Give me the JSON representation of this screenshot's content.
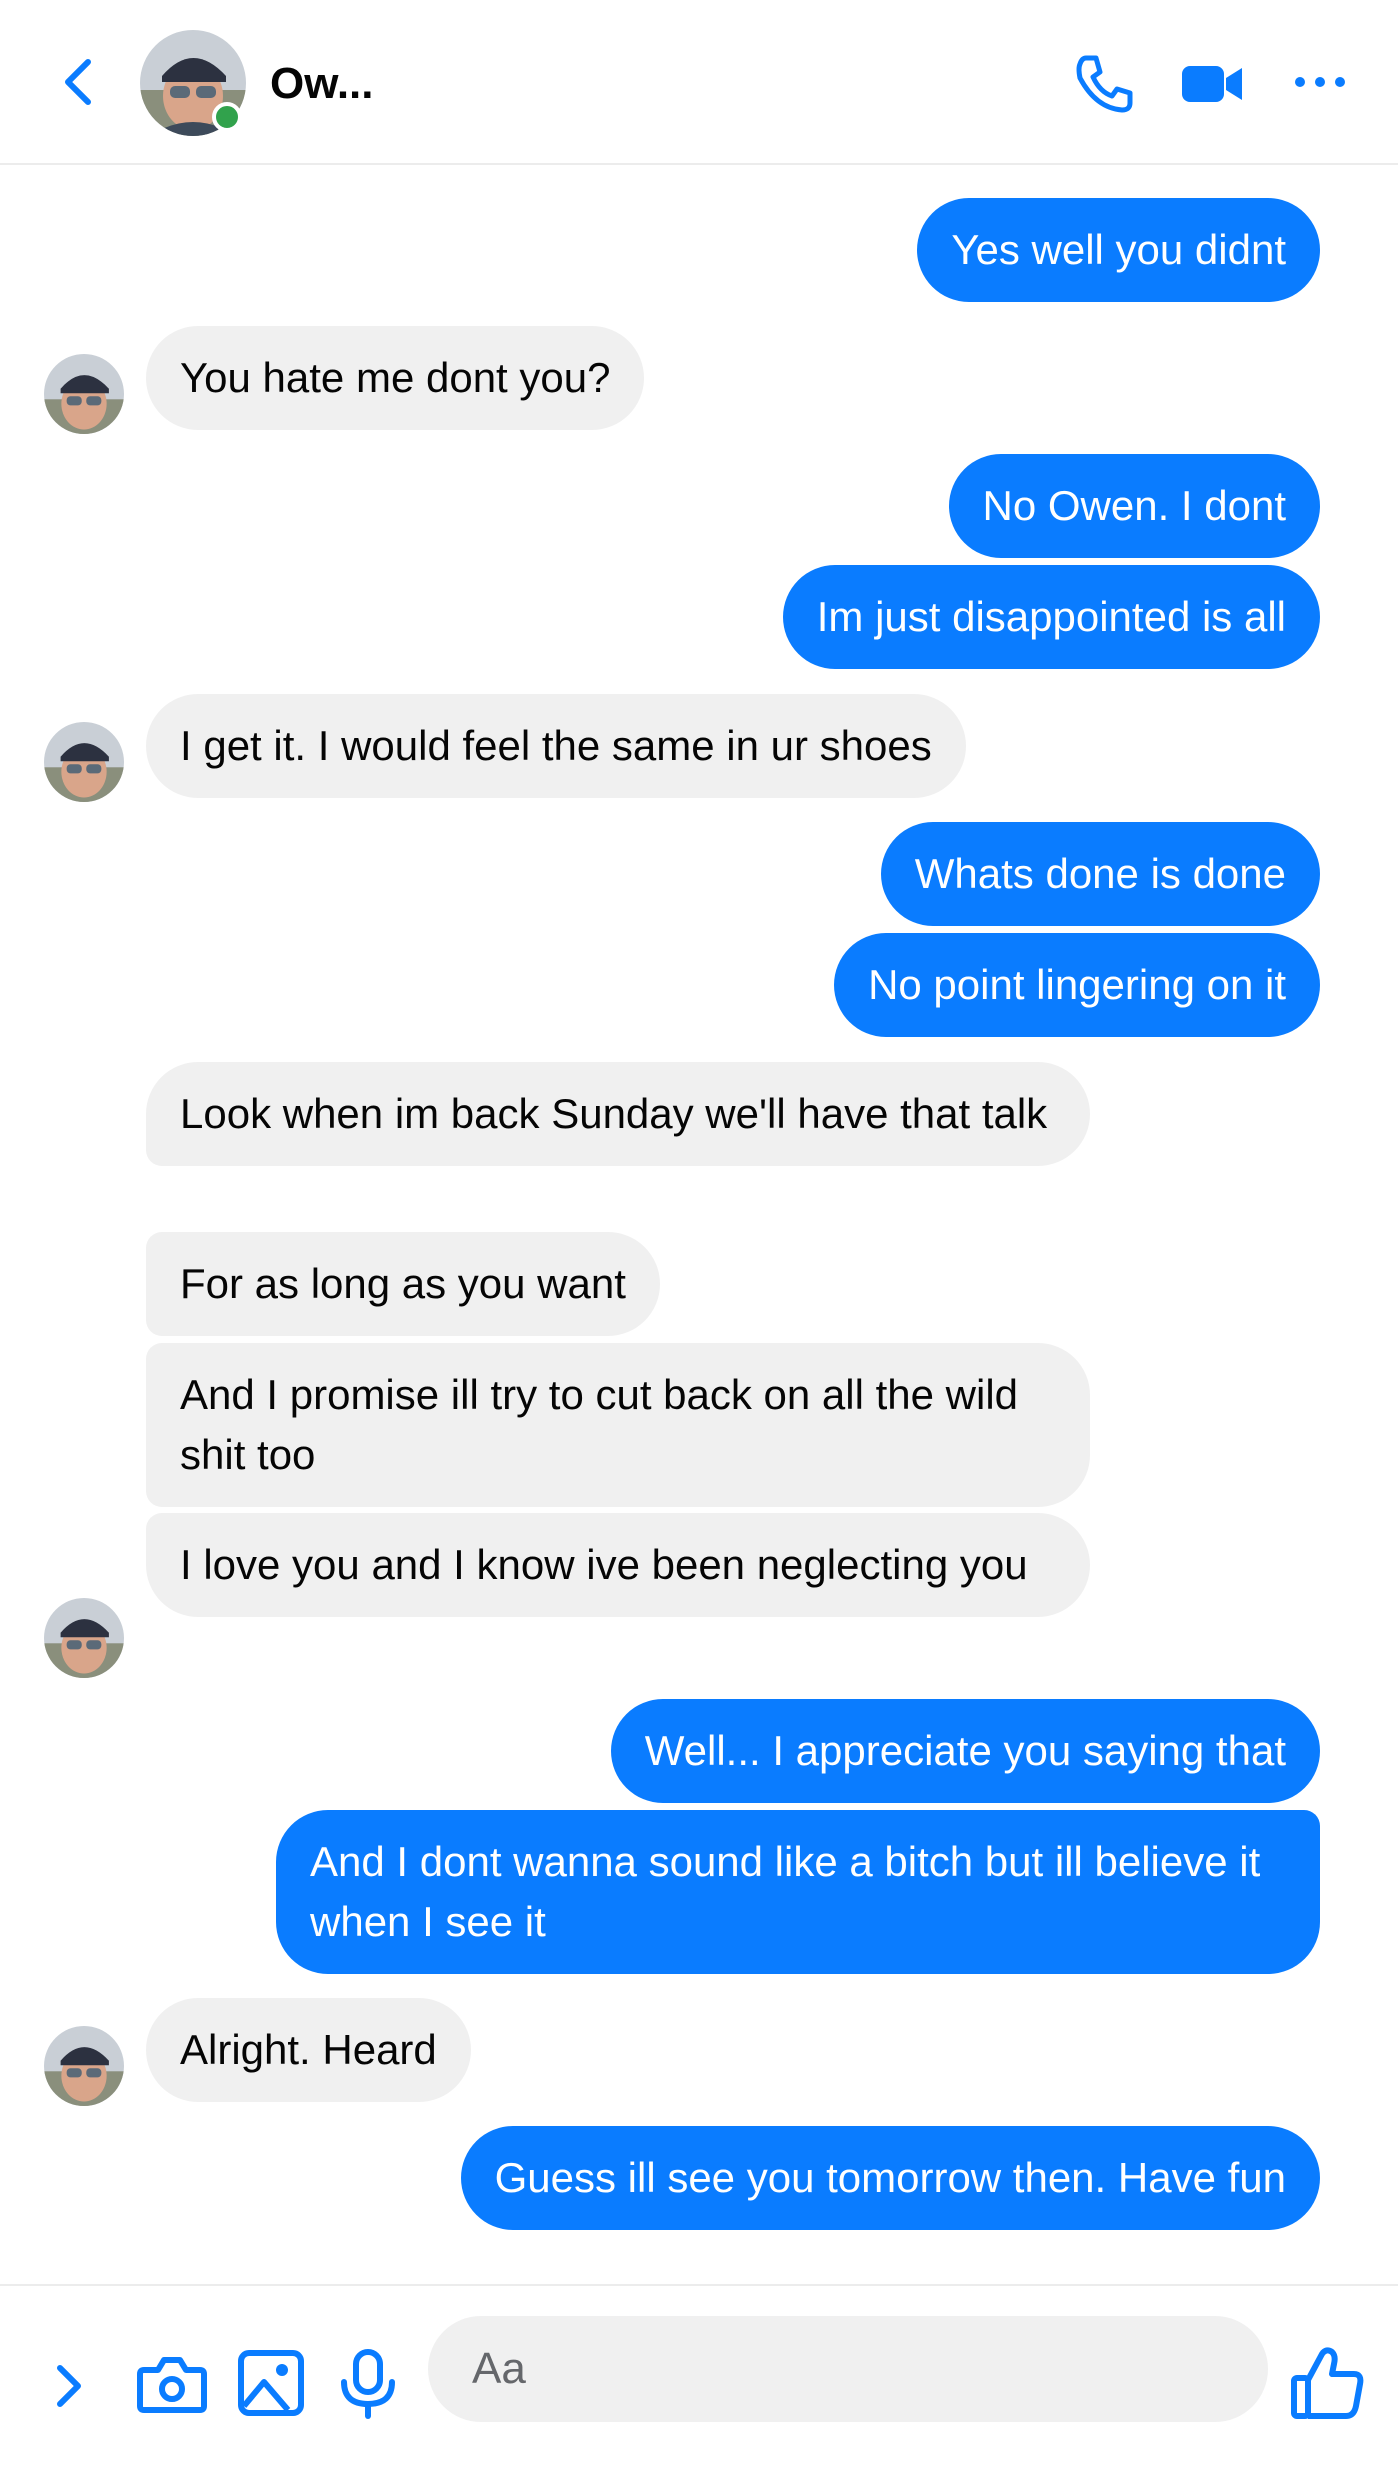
{
  "header": {
    "contact_name": "Ow...",
    "icons": {
      "back": "chevron-left-icon",
      "call": "phone-icon",
      "video": "video-camera-icon",
      "more": "ellipsis-icon"
    },
    "online": true
  },
  "colors": {
    "accent": "#0a7cff",
    "incoming_bubble": "#f0f0f0",
    "online": "#31a24c"
  },
  "messages": [
    {
      "dir": "out",
      "text": "Yes well you didnt"
    },
    {
      "dir": "in",
      "text": "You hate me dont you?"
    },
    {
      "dir": "out",
      "text": "No Owen. I dont"
    },
    {
      "dir": "out",
      "text": "Im just disappointed is all"
    },
    {
      "dir": "in",
      "text": "I get it. I would feel the same in ur shoes"
    },
    {
      "dir": "out",
      "text": "Whats done is done"
    },
    {
      "dir": "out",
      "text": "No point lingering on it"
    },
    {
      "dir": "in",
      "text": "Look when im back Sunday we'll have that talk"
    },
    {
      "dir": "in",
      "text": "For as long as you want"
    },
    {
      "dir": "in",
      "text": "And I promise ill try to cut back on all the wild shit too"
    },
    {
      "dir": "in",
      "text": "I love you and I know ive been neglecting you"
    },
    {
      "dir": "out",
      "text": "Well... I appreciate you saying that"
    },
    {
      "dir": "out",
      "text": "And I dont wanna sound like a bitch but ill believe it when I see it"
    },
    {
      "dir": "in",
      "text": "Alright. Heard"
    },
    {
      "dir": "out",
      "text": "Guess ill see you tomorrow then. Have fun"
    }
  ],
  "composer": {
    "placeholder": "Aa",
    "icons": {
      "expand": "chevron-right-icon",
      "camera": "camera-icon",
      "gallery": "image-icon",
      "mic": "microphone-icon",
      "like": "thumbs-up-icon"
    }
  }
}
